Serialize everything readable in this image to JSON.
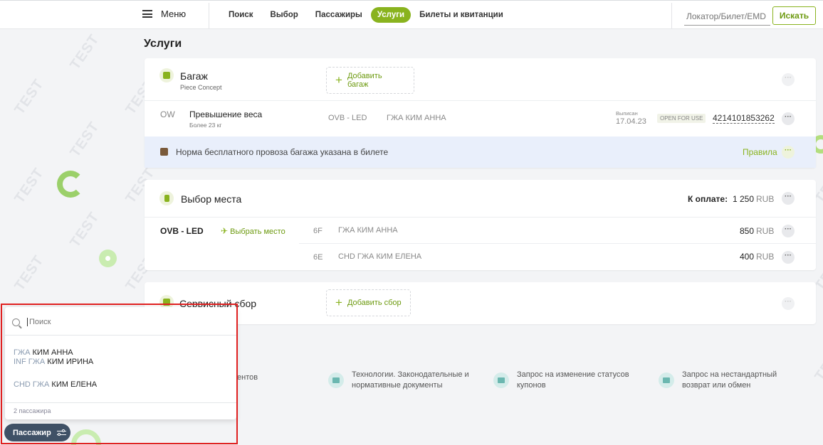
{
  "topbar": {
    "menu_label": "Меню",
    "tabs": [
      {
        "label": "Поиск",
        "active": false
      },
      {
        "label": "Выбор",
        "active": false
      },
      {
        "label": "Пассажиры",
        "active": false
      },
      {
        "label": "Услуги",
        "active": true
      },
      {
        "label": "Билеты и квитанции",
        "active": false
      }
    ],
    "locator_placeholder": "Локатор/Билет/EMD",
    "search_label": "Искать"
  },
  "watermark": "TEST",
  "page_title": "Услуги",
  "baggage": {
    "title": "Багаж",
    "subtitle": "Piece Concept",
    "add_label": "Добавить багаж",
    "row": {
      "type": "OW",
      "name": "Превышение веса",
      "note": "Более 23 кг",
      "route": "OVB - LED",
      "passenger": "ГЖА КИМ АННА",
      "issued_label": "Выписан",
      "issued_date": "17.04.23",
      "status": "OPEN FOR USE",
      "document": "4214101853262"
    },
    "info_text": "Норма бесплатного провоза багажа указана в билете",
    "rules_label": "Правила"
  },
  "seats": {
    "title": "Выбор места",
    "to_pay_label": "К оплате:",
    "to_pay_value": "1 250",
    "currency": "RUB",
    "route": "OVB - LED",
    "choose_label": "Выбрать место",
    "rows": [
      {
        "seat": "6F",
        "passenger": "ГЖА КИМ АННА",
        "price": "850",
        "currency": "RUB"
      },
      {
        "seat": "6E",
        "passenger": "CHD ГЖА КИМ ЕЛЕНА",
        "price": "400",
        "currency": "RUB"
      }
    ]
  },
  "service_fee": {
    "title": "Сервисный сбор",
    "add_label": "Добавить сбор"
  },
  "footer": {
    "partial_label": "ентов",
    "items": [
      {
        "line1": "Технологии. Законодательные и",
        "line2": "нормативные документы"
      },
      {
        "line1": "Запрос на изменение статусов",
        "line2": "купонов"
      },
      {
        "line1": "Запрос на нестандартный",
        "line2": "возврат или обмен"
      }
    ]
  },
  "passenger_popup": {
    "search_placeholder": "Поиск",
    "passengers": [
      {
        "prefix": "ГЖА",
        "name": "КИМ АННА"
      },
      {
        "prefix": "INF ГЖА",
        "name": "КИМ ИРИНА"
      },
      {
        "prefix": "CHD ГЖА",
        "name": "КИМ ЕЛЕНА"
      }
    ],
    "count_label": "2 пассажира",
    "button_label": "Пассажир"
  },
  "colors": {
    "accent": "#89b31e",
    "highlight_frame": "#e02020",
    "info_bg": "#e9effb"
  }
}
